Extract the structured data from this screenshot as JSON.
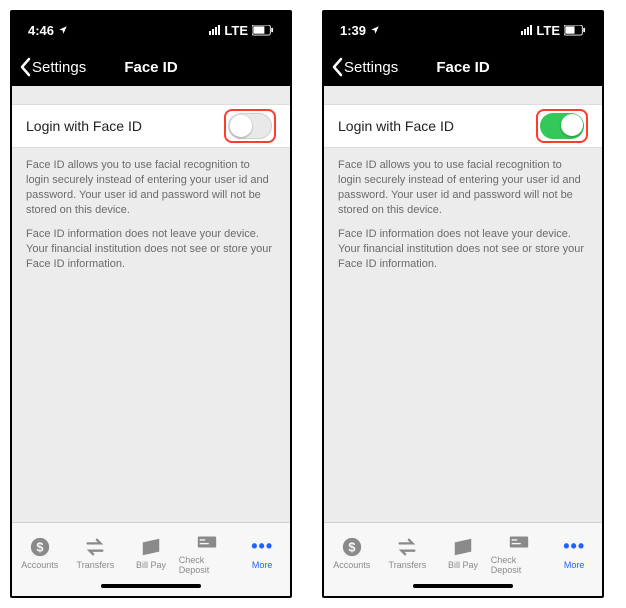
{
  "screens": [
    {
      "status": {
        "time": "4:46",
        "network": "LTE"
      },
      "nav": {
        "back": "Settings",
        "title": "Face ID"
      },
      "setting": {
        "label": "Login with Face ID",
        "enabled": false
      },
      "desc": {
        "p1": "Face ID allows you to use facial recognition to login securely instead of entering your user id and password. Your user id and password will not be stored on this device.",
        "p2": "Face ID information does not leave your device. Your financial institution does not see or store your Face ID information."
      },
      "tabs": {
        "accounts": "Accounts",
        "transfers": "Transfers",
        "billpay": "Bill Pay",
        "checkdeposit": "Check Deposit",
        "more": "More"
      }
    },
    {
      "status": {
        "time": "1:39",
        "network": "LTE"
      },
      "nav": {
        "back": "Settings",
        "title": "Face ID"
      },
      "setting": {
        "label": "Login with Face ID",
        "enabled": true
      },
      "desc": {
        "p1": "Face ID allows you to use facial recognition to login securely instead of entering your user id and password. Your user id and password will not be stored on this device.",
        "p2": "Face ID information does not leave your device. Your financial institution does not see or store your Face ID information."
      },
      "tabs": {
        "accounts": "Accounts",
        "transfers": "Transfers",
        "billpay": "Bill Pay",
        "checkdeposit": "Check Deposit",
        "more": "More"
      }
    }
  ]
}
